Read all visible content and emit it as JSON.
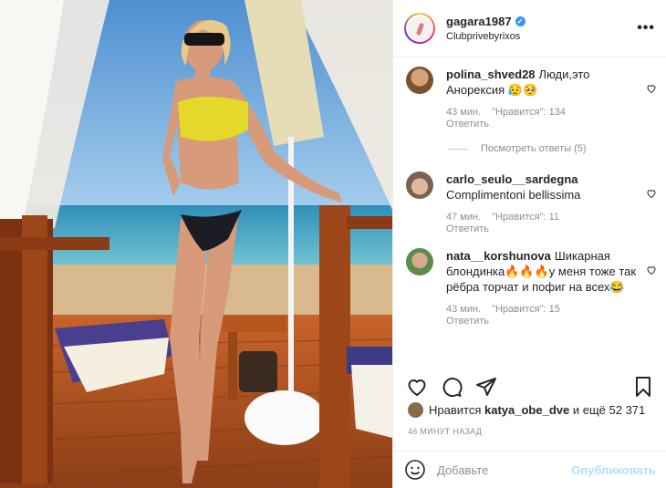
{
  "post": {
    "username": "gagara1987",
    "verified_mark": "✓",
    "location": "Clubprivebyrixos",
    "more_icon": "•••"
  },
  "comments": [
    {
      "user": "polina_shved28",
      "text": "Люди,это Анорексия 😥🥺",
      "time": "43 мин.",
      "likes": "\"Нравится\": 134",
      "reply": "Ответить"
    },
    {
      "user": "carlo_seulo__sardegna",
      "text": "Complimentoni bellissima",
      "time": "47 мин.",
      "likes": "\"Нравится\": 11",
      "reply": "Ответить"
    },
    {
      "user": "nata__korshunova",
      "text": "Шикарная блондинка🔥🔥🔥у меня тоже так рёбра торчат и пофиг на всех😂",
      "time": "43 мин.",
      "likes": "\"Нравится\": 15",
      "reply": "Ответить"
    }
  ],
  "view_replies": "Посмотреть ответы (5)",
  "likes_line": {
    "prefix": "Нравится",
    "user": "katya_obe_dve",
    "suffix": "и ещё 52 371"
  },
  "posted_ago": "46 МИНУТ НАЗАД",
  "comment_input": {
    "placeholder": "Добавьте",
    "publish": "Опубликовать"
  },
  "colors": {
    "accent": "#3897f0",
    "publish_disabled": "#b2dffc",
    "muted": "#8e8e8e"
  },
  "icons": [
    "heart-icon",
    "comment-icon",
    "share-icon",
    "bookmark-icon",
    "emoji-icon",
    "more-icon"
  ]
}
